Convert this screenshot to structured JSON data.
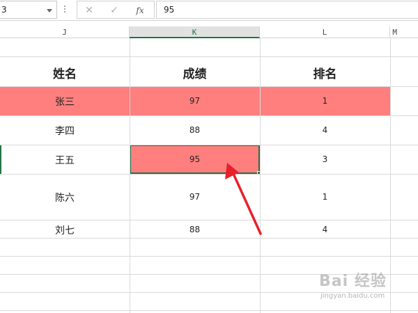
{
  "formula_bar": {
    "name_box": "3",
    "cancel_icon": "✕",
    "enter_icon": "✓",
    "fx_label": "fx",
    "value": "95"
  },
  "columns": [
    "J",
    "K",
    "L",
    "M"
  ],
  "table": {
    "headers": [
      "姓名",
      "成绩",
      "排名"
    ],
    "rows": [
      {
        "name": "张三",
        "score": "97",
        "rank": "1",
        "highlighted": true
      },
      {
        "name": "李四",
        "score": "88",
        "rank": "4",
        "highlighted": false
      },
      {
        "name": "王五",
        "score": "95",
        "rank": "3",
        "highlighted": false
      },
      {
        "name": "陈六",
        "score": "97",
        "rank": "1",
        "highlighted": false
      },
      {
        "name": "刘七",
        "score": "88",
        "rank": "4",
        "highlighted": false
      }
    ]
  },
  "selection": {
    "cell": "K",
    "value": "95"
  },
  "colors": {
    "highlight": "#ff7f7f",
    "selection_border": "#217346",
    "arrow": "#e8202a"
  },
  "watermark": {
    "logo": "Bai 经验",
    "url": "jingyan.baidu.com"
  }
}
